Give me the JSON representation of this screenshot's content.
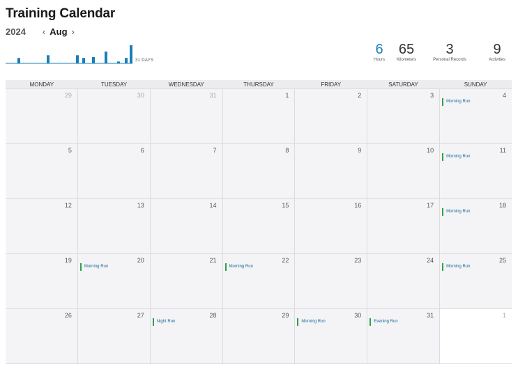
{
  "header": {
    "title": "Training Calendar",
    "year": "2024",
    "month": "Aug",
    "prev_icon": "‹",
    "next_icon": "›"
  },
  "summary_chart": {
    "label": "31 DAYS",
    "accent": "#1a7fb8",
    "bars": [
      0.3,
      0.45,
      0.45,
      0.3,
      0.35,
      0.65,
      0.1,
      0.3,
      1.0
    ]
  },
  "stats": [
    {
      "value": "6",
      "label": "Hours",
      "accent": true
    },
    {
      "value": "65",
      "label": "Kilometers",
      "accent": false
    },
    {
      "value": "3",
      "label": "Personal Records",
      "accent": false
    },
    {
      "value": "9",
      "label": "Activities",
      "accent": false
    }
  ],
  "weekdays": [
    "MONDAY",
    "TUESDAY",
    "WEDNESDAY",
    "THURSDAY",
    "FRIDAY",
    "SATURDAY",
    "SUNDAY"
  ],
  "weeks": [
    [
      {
        "day": "29",
        "dim": true
      },
      {
        "day": "30",
        "dim": true
      },
      {
        "day": "31",
        "dim": true
      },
      {
        "day": "1"
      },
      {
        "day": "2"
      },
      {
        "day": "3"
      },
      {
        "day": "4",
        "activity": "Morning Run"
      }
    ],
    [
      {
        "day": "5"
      },
      {
        "day": "6"
      },
      {
        "day": "7"
      },
      {
        "day": "8"
      },
      {
        "day": "9"
      },
      {
        "day": "10"
      },
      {
        "day": "11",
        "activity": "Morning Run"
      }
    ],
    [
      {
        "day": "12"
      },
      {
        "day": "13"
      },
      {
        "day": "14"
      },
      {
        "day": "15"
      },
      {
        "day": "16"
      },
      {
        "day": "17"
      },
      {
        "day": "18",
        "activity": "Morning Run"
      }
    ],
    [
      {
        "day": "19"
      },
      {
        "day": "20",
        "activity": "Morning Run"
      },
      {
        "day": "21"
      },
      {
        "day": "22",
        "activity": "Morning Run"
      },
      {
        "day": "23"
      },
      {
        "day": "24"
      },
      {
        "day": "25",
        "activity": "Morning Run"
      }
    ],
    [
      {
        "day": "26"
      },
      {
        "day": "27"
      },
      {
        "day": "28",
        "activity": "Night Run"
      },
      {
        "day": "29"
      },
      {
        "day": "30",
        "activity": "Morning Run"
      },
      {
        "day": "31",
        "activity": "Evening Run"
      },
      {
        "day": "1",
        "dim": true,
        "today": true
      }
    ]
  ]
}
